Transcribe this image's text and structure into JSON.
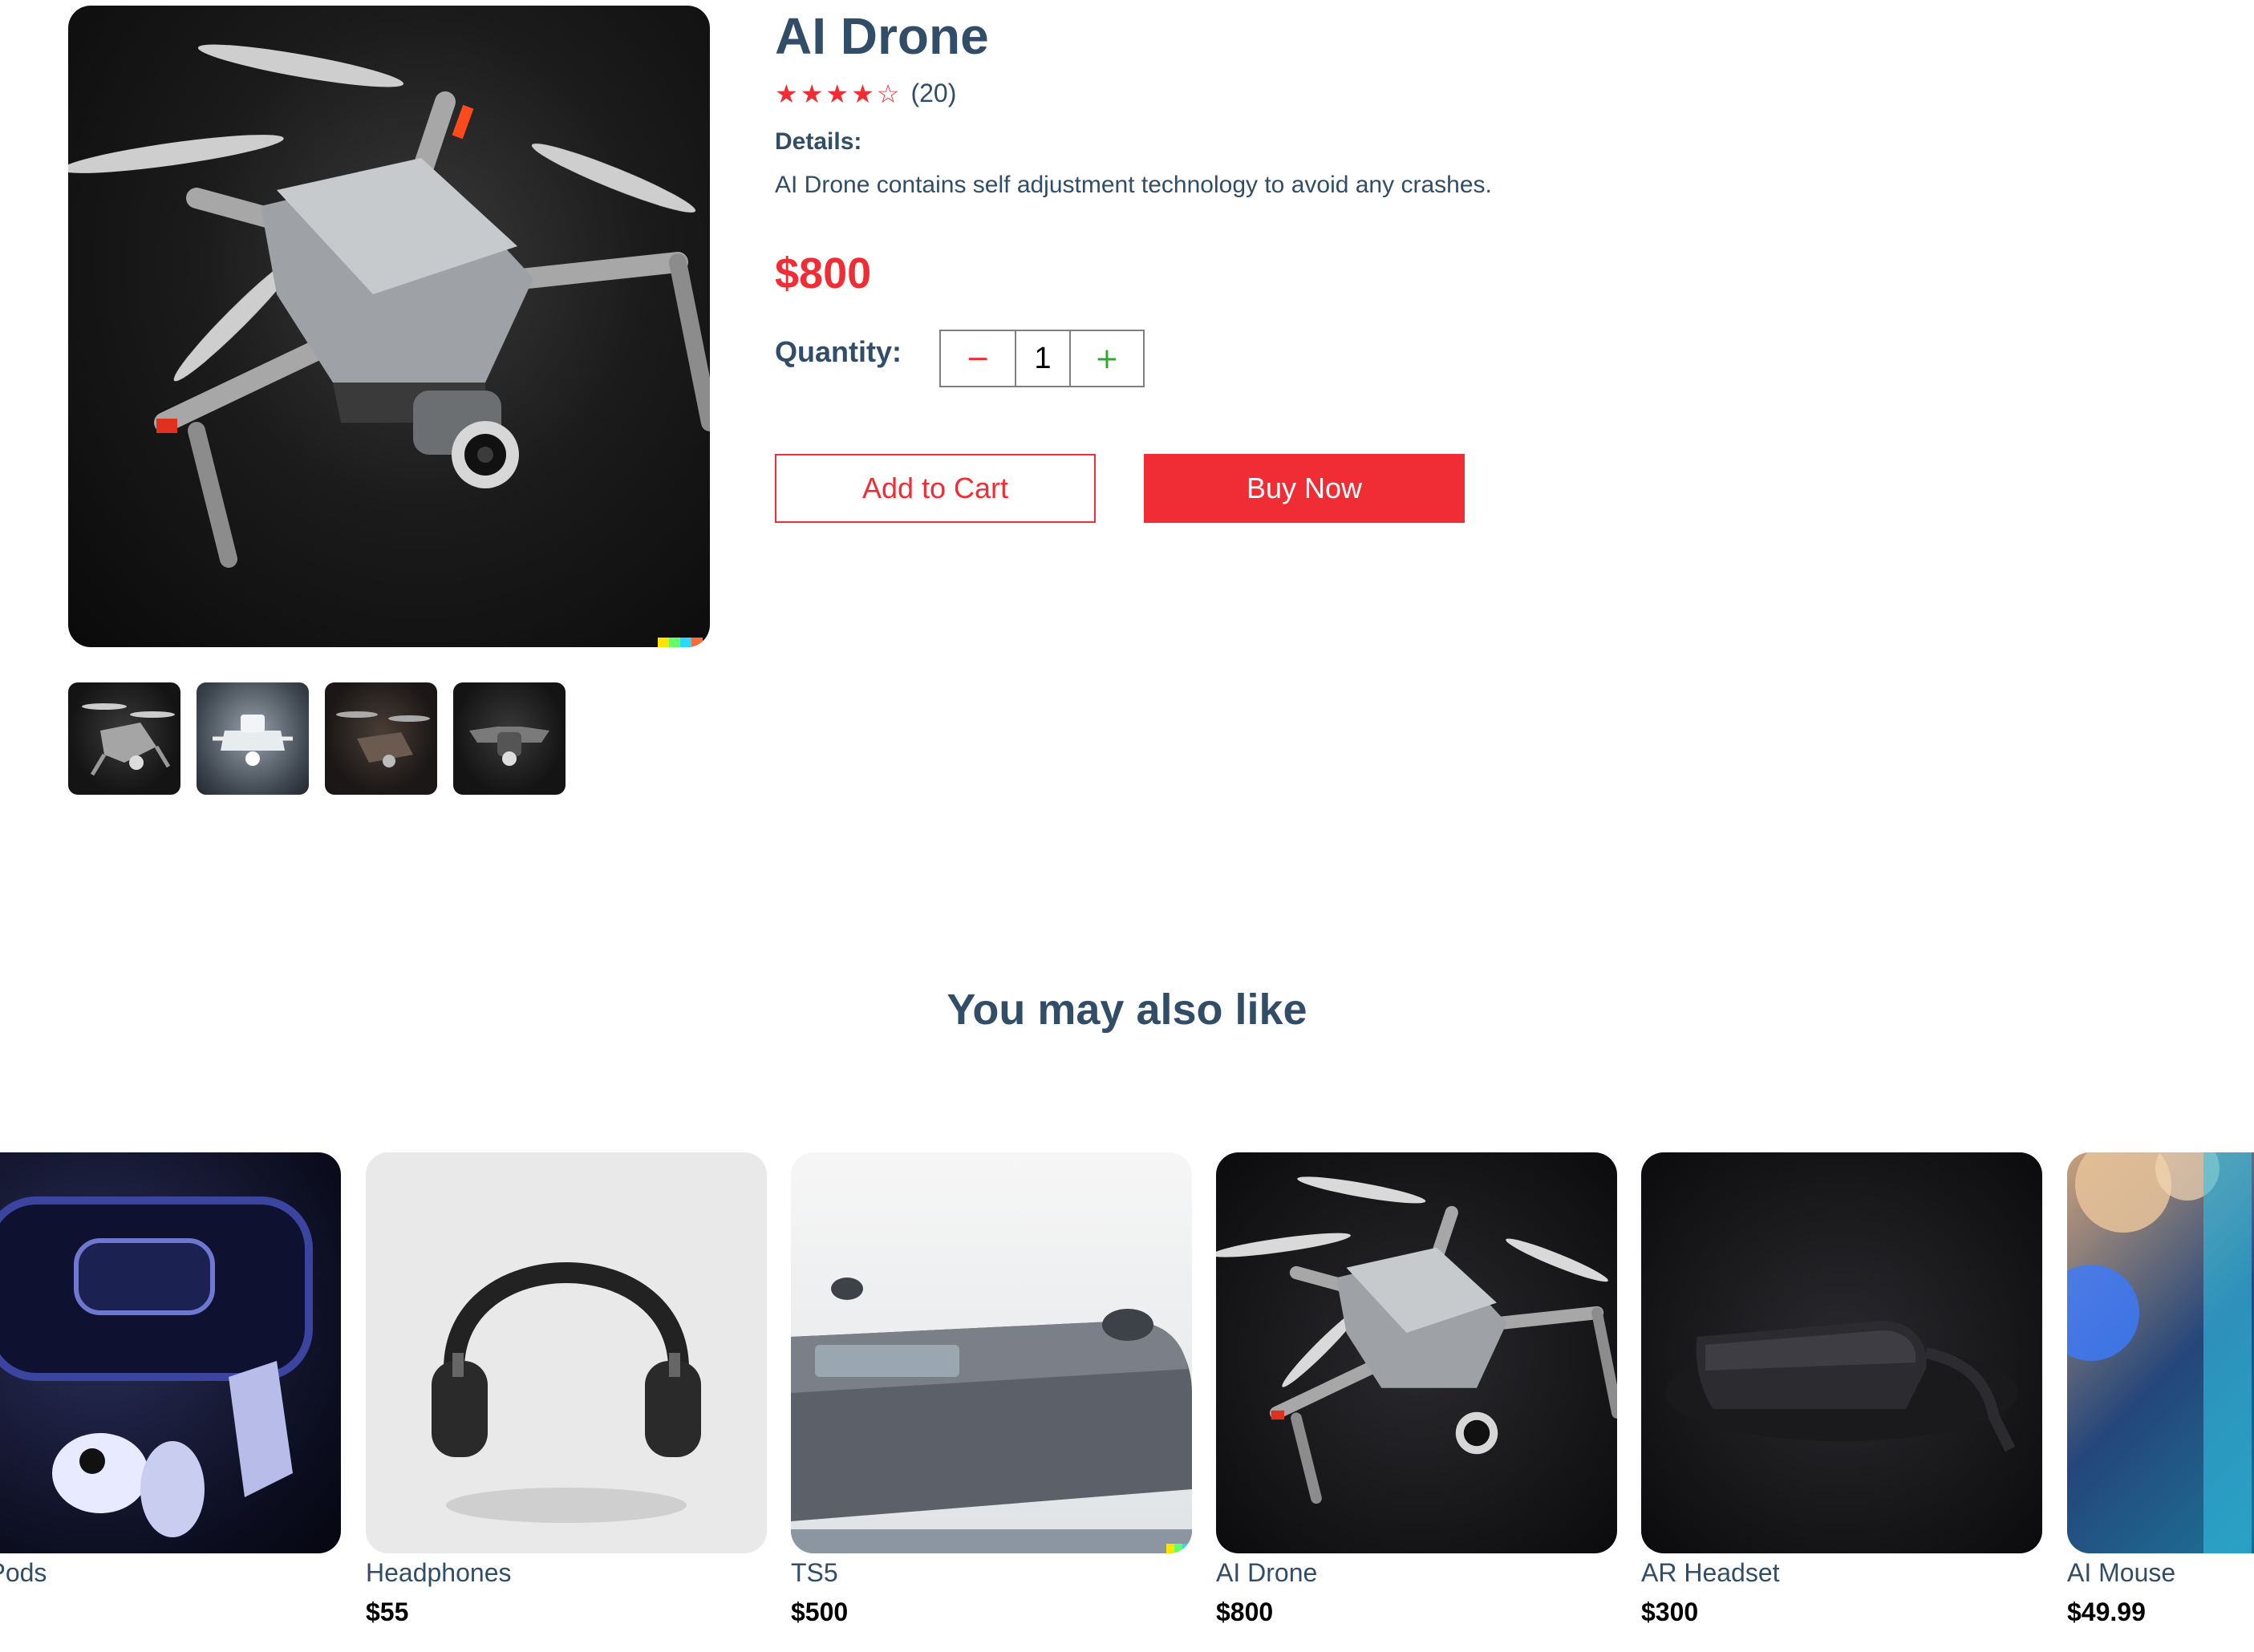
{
  "product": {
    "title": "AI Drone",
    "rating_stars": 4,
    "rating_max": 5,
    "review_count": "(20)",
    "details_label": "Details:",
    "description": "AI Drone contains self adjustment technology to avoid any crashes.",
    "price": "$800",
    "quantity_label": "Quantity:",
    "quantity_value": "1",
    "minus_glyph": "−",
    "plus_glyph": "+",
    "add_to_cart_label": "Add to Cart",
    "buy_now_label": "Buy Now"
  },
  "icons": {
    "star_filled": "star-icon",
    "star_empty": "star-outline-icon",
    "minus": "minus-icon",
    "plus": "plus-icon"
  },
  "recommendations": {
    "heading": "You may also like",
    "items": [
      {
        "name": "/ind Pods",
        "price": ""
      },
      {
        "name": "Headphones",
        "price": "$55"
      },
      {
        "name": "TS5",
        "price": "$500"
      },
      {
        "name": "AI Drone",
        "price": "$800"
      },
      {
        "name": "AR Headset",
        "price": "$300"
      },
      {
        "name": "AI Mouse",
        "price": "$49.99"
      }
    ]
  },
  "colors": {
    "accent": "#f02d34",
    "text": "#324d67",
    "plus": "#31a831"
  }
}
